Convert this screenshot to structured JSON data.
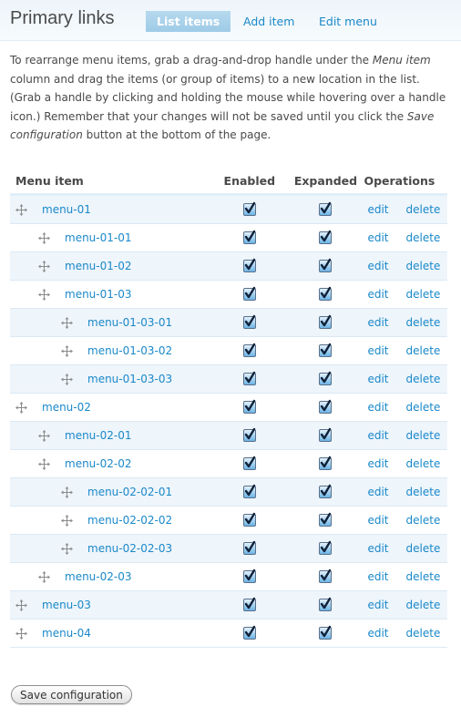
{
  "header": {
    "title": "Primary links",
    "tabs": [
      {
        "label": "List items",
        "active": true
      },
      {
        "label": "Add item",
        "active": false
      },
      {
        "label": "Edit menu",
        "active": false
      }
    ]
  },
  "description": {
    "part1": "To rearrange menu items, grab a drag-and-drop handle under the ",
    "em1": "Menu item",
    "part2": " column and drag the items (or group of items) to a new location in the list. (Grab a handle by clicking and holding the mouse while hovering over a handle icon.) Remember that your changes will not be saved until you click the ",
    "em2": "Save configuration",
    "part3": " button at the bottom of the page."
  },
  "table": {
    "headers": {
      "item": "Menu item",
      "enabled": "Enabled",
      "expanded": "Expanded",
      "operations": "Operations"
    },
    "edit_label": "edit",
    "delete_label": "delete",
    "rows": [
      {
        "label": "menu-01",
        "depth": 0,
        "enabled": true,
        "expanded": true
      },
      {
        "label": "menu-01-01",
        "depth": 1,
        "enabled": true,
        "expanded": true
      },
      {
        "label": "menu-01-02",
        "depth": 1,
        "enabled": true,
        "expanded": true
      },
      {
        "label": "menu-01-03",
        "depth": 1,
        "enabled": true,
        "expanded": true
      },
      {
        "label": "menu-01-03-01",
        "depth": 2,
        "enabled": true,
        "expanded": true
      },
      {
        "label": "menu-01-03-02",
        "depth": 2,
        "enabled": true,
        "expanded": true
      },
      {
        "label": "menu-01-03-03",
        "depth": 2,
        "enabled": true,
        "expanded": true
      },
      {
        "label": "menu-02",
        "depth": 0,
        "enabled": true,
        "expanded": true
      },
      {
        "label": "menu-02-01",
        "depth": 1,
        "enabled": true,
        "expanded": true
      },
      {
        "label": "menu-02-02",
        "depth": 1,
        "enabled": true,
        "expanded": true
      },
      {
        "label": "menu-02-02-01",
        "depth": 2,
        "enabled": true,
        "expanded": true
      },
      {
        "label": "menu-02-02-02",
        "depth": 2,
        "enabled": true,
        "expanded": true
      },
      {
        "label": "menu-02-02-03",
        "depth": 2,
        "enabled": true,
        "expanded": true
      },
      {
        "label": "menu-02-03",
        "depth": 1,
        "enabled": true,
        "expanded": true
      },
      {
        "label": "menu-03",
        "depth": 0,
        "enabled": true,
        "expanded": true
      },
      {
        "label": "menu-04",
        "depth": 0,
        "enabled": true,
        "expanded": true
      }
    ]
  },
  "save_button_label": "Save configuration",
  "colors": {
    "link": "#1a88c9",
    "active_tab": "#a9d1ea",
    "row_stripe": "#eef5fb"
  }
}
